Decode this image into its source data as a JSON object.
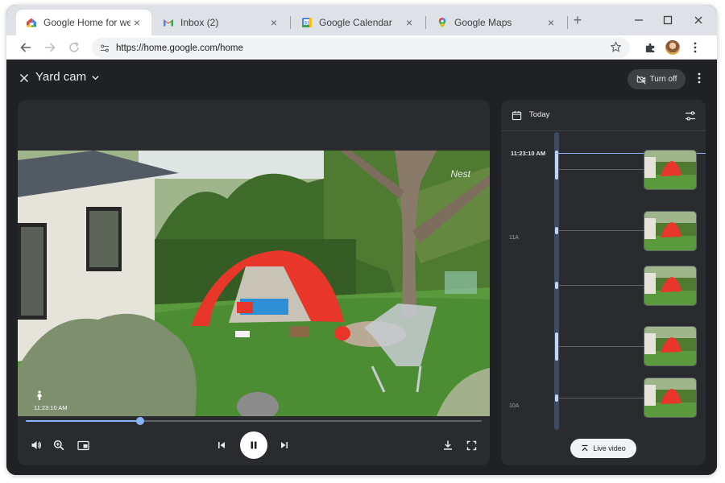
{
  "browser": {
    "tabs": [
      {
        "label": "Google Home for web",
        "icon": "google-home-icon",
        "active": true
      },
      {
        "label": "Inbox (2)",
        "icon": "gmail-icon",
        "active": false
      },
      {
        "label": "Google Calendar",
        "icon": "calendar-icon",
        "active": false
      },
      {
        "label": "Google Maps",
        "icon": "maps-icon",
        "active": false
      }
    ],
    "url": "https://home.google.com/home"
  },
  "app": {
    "camera_name": "Yard cam",
    "turn_off_label": "Turn off",
    "video": {
      "brand": "Nest",
      "timestamp": "11:23:10 AM",
      "playback_progress": 0.25
    },
    "timeline": {
      "day_label": "Today",
      "current_time": "11:23:10 AM",
      "hour_labels": [
        "11A",
        "10A"
      ],
      "live_label": "Live video"
    }
  },
  "colors": {
    "background": "#202124",
    "panel": "#2a2b2e",
    "accent": "#8ab4f8",
    "tent": "#e8362b"
  }
}
